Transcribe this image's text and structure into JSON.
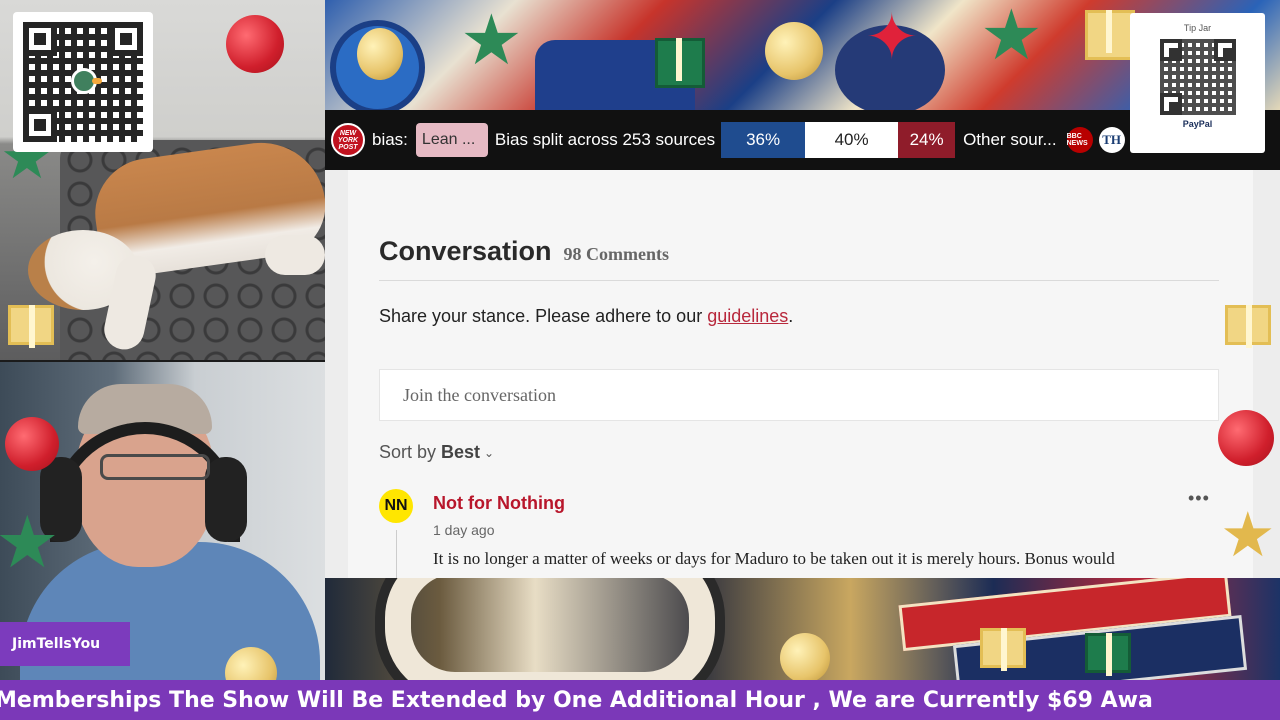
{
  "stream": {
    "name_tag": "JimTellsYou",
    "ticker_text": "Memberships The Show Will Be Extended by One Additional Hour , We are Currently $69 Awa",
    "tip_jar": {
      "title": "Tip Jar",
      "provider": "PayPal"
    }
  },
  "bias_bar": {
    "outlet_logo_text": "NEW YORK POST",
    "label": "bias:",
    "lean_chip": "Lean ...",
    "split_text": "Bias split across 253 sources",
    "left_pct": "36%",
    "center_pct": "40%",
    "right_pct": "24%",
    "left_fraction": 0.36,
    "center_fraction": 0.4,
    "right_fraction": 0.24,
    "other_text": "Other sour...",
    "source_badges": [
      {
        "text": "BBC NEWS",
        "icon": "bbc-news-logo",
        "color": "#b80000"
      },
      {
        "text": "TH",
        "icon": "the-hill-logo",
        "color": "#ffffff"
      }
    ],
    "colors": {
      "left": "#1f4c8f",
      "center": "#ffffff",
      "right": "#8f1c2a",
      "lean_chip": "#e6bac4"
    }
  },
  "conversation": {
    "title": "Conversation",
    "count": "98 Comments",
    "share_prefix": "Share your stance. Please adhere to our ",
    "guidelines_link": "guidelines",
    "share_suffix": ".",
    "input_placeholder": "Join the conversation",
    "sort_label": "Sort by",
    "sort_value": "Best",
    "comments": [
      {
        "avatar": "NN",
        "author": "Not for Nothing",
        "time": "1 day ago",
        "body": "It is no longer a matter of weeks or days for Maduro to be taken out it is merely hours.  Bonus would"
      }
    ]
  },
  "colors": {
    "accent_red": "#b8162b",
    "ticker_purple": "#7b38b8",
    "avatar_yellow": "#ffe600"
  }
}
